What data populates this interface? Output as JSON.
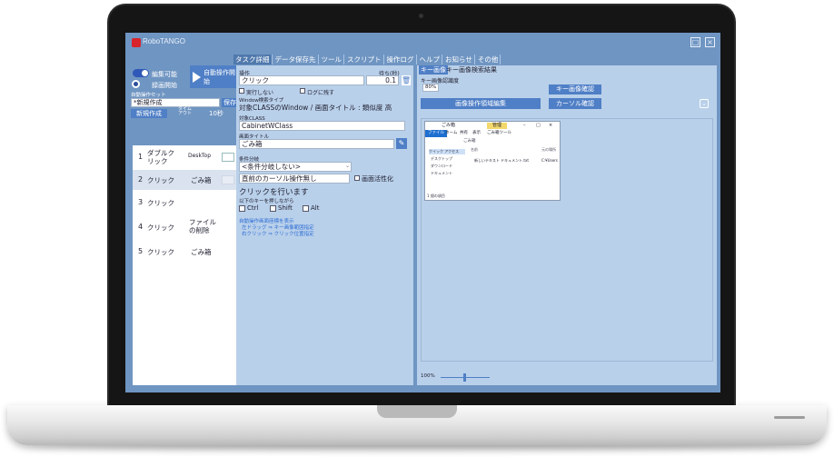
{
  "app": {
    "title": "RoboTANGO"
  },
  "menu": [
    "タスク詳細",
    "データ保存先",
    "ツール",
    "スクリプト",
    "操作ログ",
    "ヘルプ",
    "お知らせ",
    "その他"
  ],
  "left": {
    "edit_toggle_label": "編集可能",
    "record_label": "録画開始",
    "auto_run_label": "自動操作開始",
    "set_label": "自動操作セット",
    "set_name": "*新規作成",
    "save_label": "保存",
    "new_label": "新規作成",
    "timeout_label": "タイム\nアウト",
    "timeout_value": "10秒",
    "tasks": [
      {
        "num": "1",
        "name": "ダブルクリック",
        "target": "DeskTop"
      },
      {
        "num": "2",
        "name": "クリック",
        "target": "ごみ箱"
      },
      {
        "num": "3",
        "name": "クリック",
        "target": ""
      },
      {
        "num": "4",
        "name": "クリック",
        "target": "ファイルの削除"
      },
      {
        "num": "5",
        "name": "クリック",
        "target": "ごみ箱"
      }
    ]
  },
  "mid": {
    "op_label": "操作",
    "wait_label": "待ち(秒)",
    "op_value": "クリック",
    "wait_value": "0.1",
    "no_exec_label": "実行しない",
    "log_label": "ログに残す",
    "window_type_label": "Window検索タイプ",
    "window_type_value": "対象CLASSのWindow / 画面タイトル : 類似度 高",
    "class_label": "対象CLASS",
    "class_value": "CabinetWClass",
    "screen_title_label": "画面タイトル",
    "screen_title_value": "ごみ箱",
    "cond_label": "条件分岐",
    "cond_value": "<条件分岐しない>",
    "cursor_value": "直前のカーソル操作無し",
    "activate_label": "画面活性化",
    "action_text": "クリックを行います",
    "keys_label": "以下のキーを押しながら",
    "ctrl": "Ctrl",
    "shift": "Shift",
    "alt": "Alt",
    "links": [
      "自動操作画面座標を表示",
      "左ドラッグ ⇒ キー画像範囲指定",
      "右クリック ⇒ クリック位置指定"
    ]
  },
  "right": {
    "tab_key_image": "キー画像",
    "tab_search_result": "キー画像検索結果",
    "recog_label": "キー画像認識度",
    "recog_value": "80%",
    "key_confirm": "キー画像確認",
    "edit_image": "画像操作領域編集",
    "cursor_confirm": "カーソル確認",
    "zoom_label": "100%",
    "explorer": {
      "title": "ごみ箱",
      "manage": "管理",
      "tabs": [
        "ファイル",
        "ホーム",
        "共有",
        "表示",
        "ごみ箱ツール"
      ],
      "crumb": "ごみ箱",
      "col_name": "名前",
      "col_orig": "元の場所",
      "nav": [
        "クイック アクセス",
        "デスクトップ",
        "ダウンロード",
        "ドキュメント"
      ],
      "file": "新しいテキスト ドキュメント.txt",
      "file_orig": "C:¥Users",
      "status": "1 個の項目"
    }
  },
  "colors": {
    "accent": "#4f7fc6",
    "panel": "#b9d0ea",
    "bg": "#6f95c2"
  }
}
